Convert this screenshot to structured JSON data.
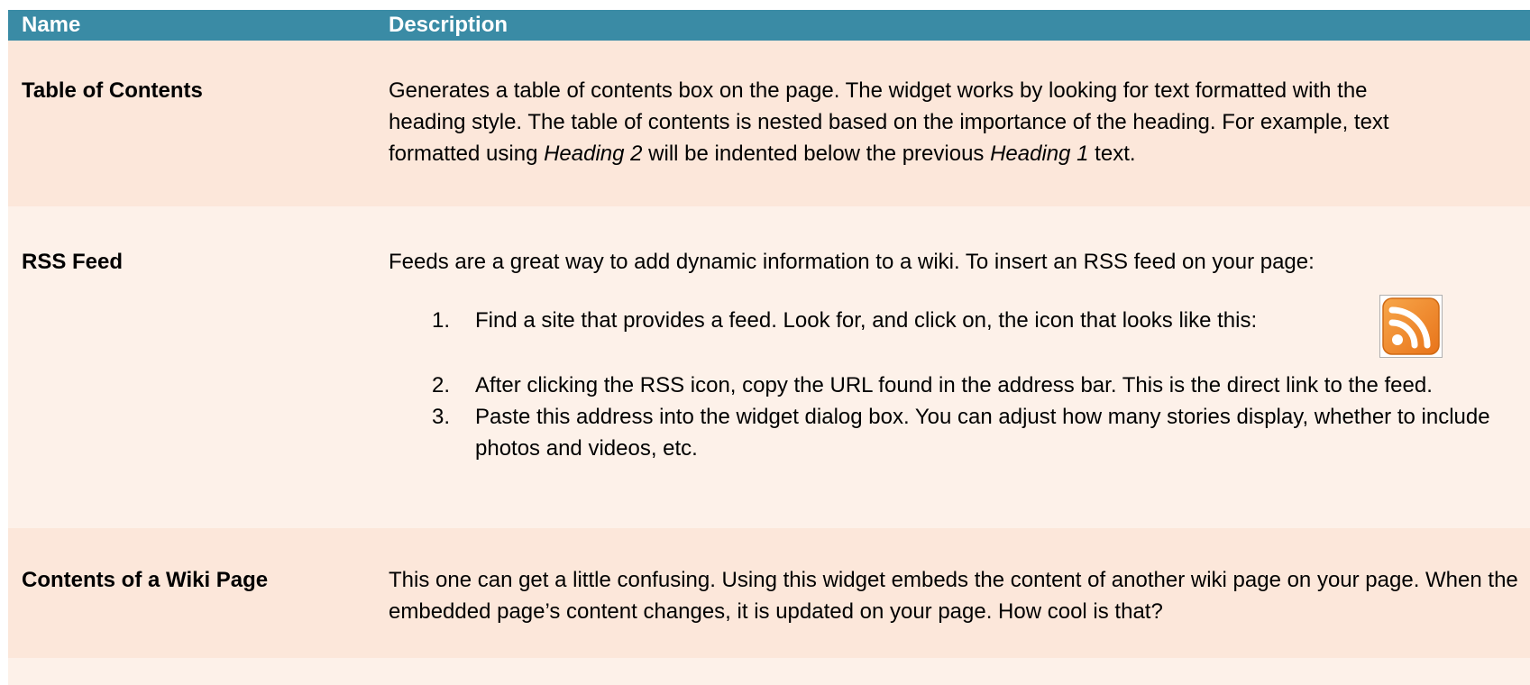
{
  "colors": {
    "header_bg": "#3a8ba5",
    "row_dark": "#fce7da",
    "row_light": "#fdf1e9",
    "rss_orange": "#f28b22"
  },
  "header": {
    "name_label": "Name",
    "description_label": "Description"
  },
  "rows": [
    {
      "name": "Table of Contents",
      "description": {
        "line1": "Generates a table of contents box on the page. The widget works by looking for text formatted with the",
        "line2": "heading style. The table of contents is nested based on the importance of the heading. For example, text",
        "line3_pre": "formatted using ",
        "line3_em1": "Heading 2",
        "line3_mid": " will be indented below the previous ",
        "line3_em2": "Heading 1",
        "line3_post": " text."
      }
    },
    {
      "name": "RSS Feed",
      "intro": "Feeds are a great way to add dynamic information to a wiki. To insert an RSS feed on your page:",
      "steps": [
        {
          "num": "1.",
          "text": "Find a site that provides a feed. Look for, and click on, the icon that looks like this:",
          "icon": "rss-icon"
        },
        {
          "num": "2.",
          "text": "After clicking the RSS icon, copy the URL found in the address bar. This is the direct link to the feed."
        },
        {
          "num": "3.",
          "text": "Paste this address into the widget dialog box. You can adjust how many stories display, whether to include photos and videos, etc."
        }
      ]
    },
    {
      "name": "Contents of a Wiki Page",
      "description": "This one can get a little confusing. Using this widget embeds the content of another wiki page on your page. When the embedded page’s content changes, it is updated on your page. How cool is that?"
    }
  ]
}
